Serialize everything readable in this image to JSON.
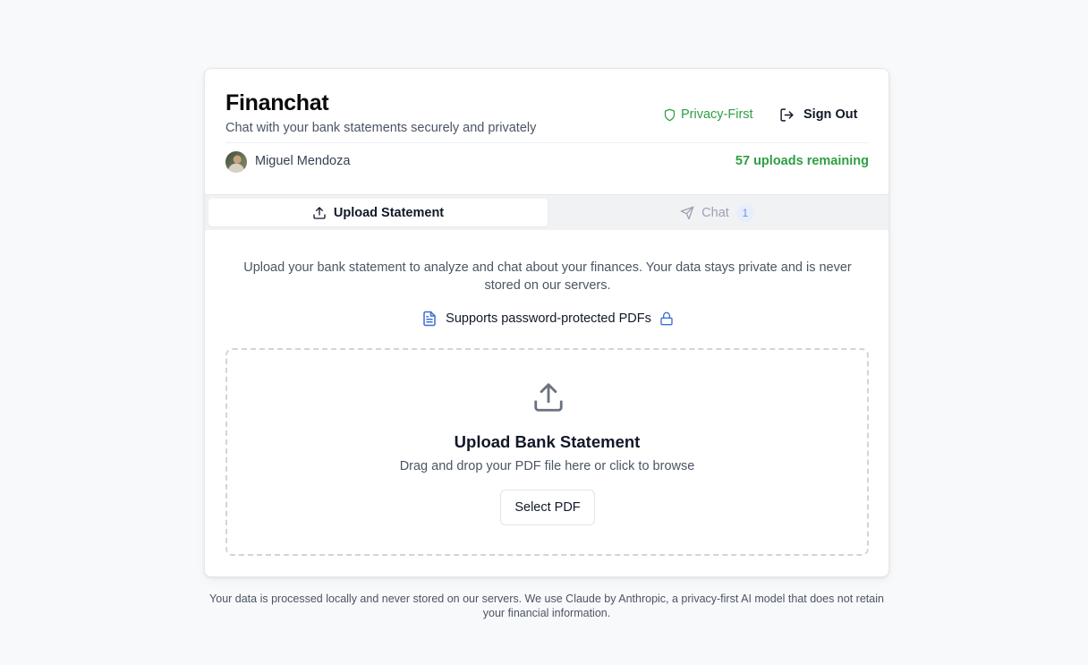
{
  "app": {
    "title": "Financhat",
    "subtitle": "Chat with your bank statements securely and privately",
    "privacy_badge": "Privacy-First",
    "sign_out": "Sign Out"
  },
  "user": {
    "name": "Miguel Mendoza",
    "uploads_remaining": "57 uploads remaining"
  },
  "tabs": [
    {
      "label": "Upload Statement",
      "icon": "upload-icon",
      "active": true
    },
    {
      "label": "Chat",
      "icon": "send-icon",
      "badge": "1",
      "active": false
    }
  ],
  "upload": {
    "intro": "Upload your bank statement to analyze and chat about your finances. Your data stays private and is never stored on our servers.",
    "password_note": "Supports password-protected PDFs",
    "drop_title": "Upload Bank Statement",
    "drop_hint": "Drag and drop your PDF file here or click to browse",
    "select_button": "Select PDF"
  },
  "footer": {
    "note": "Your data is processed locally and never stored on our servers. We use Claude by Anthropic, a privacy-first AI model that does not retain your financial information."
  },
  "colors": {
    "accent_green": "#2f9e44",
    "accent_blue": "#3b6fd4",
    "badge_bg": "#e8eefc"
  }
}
